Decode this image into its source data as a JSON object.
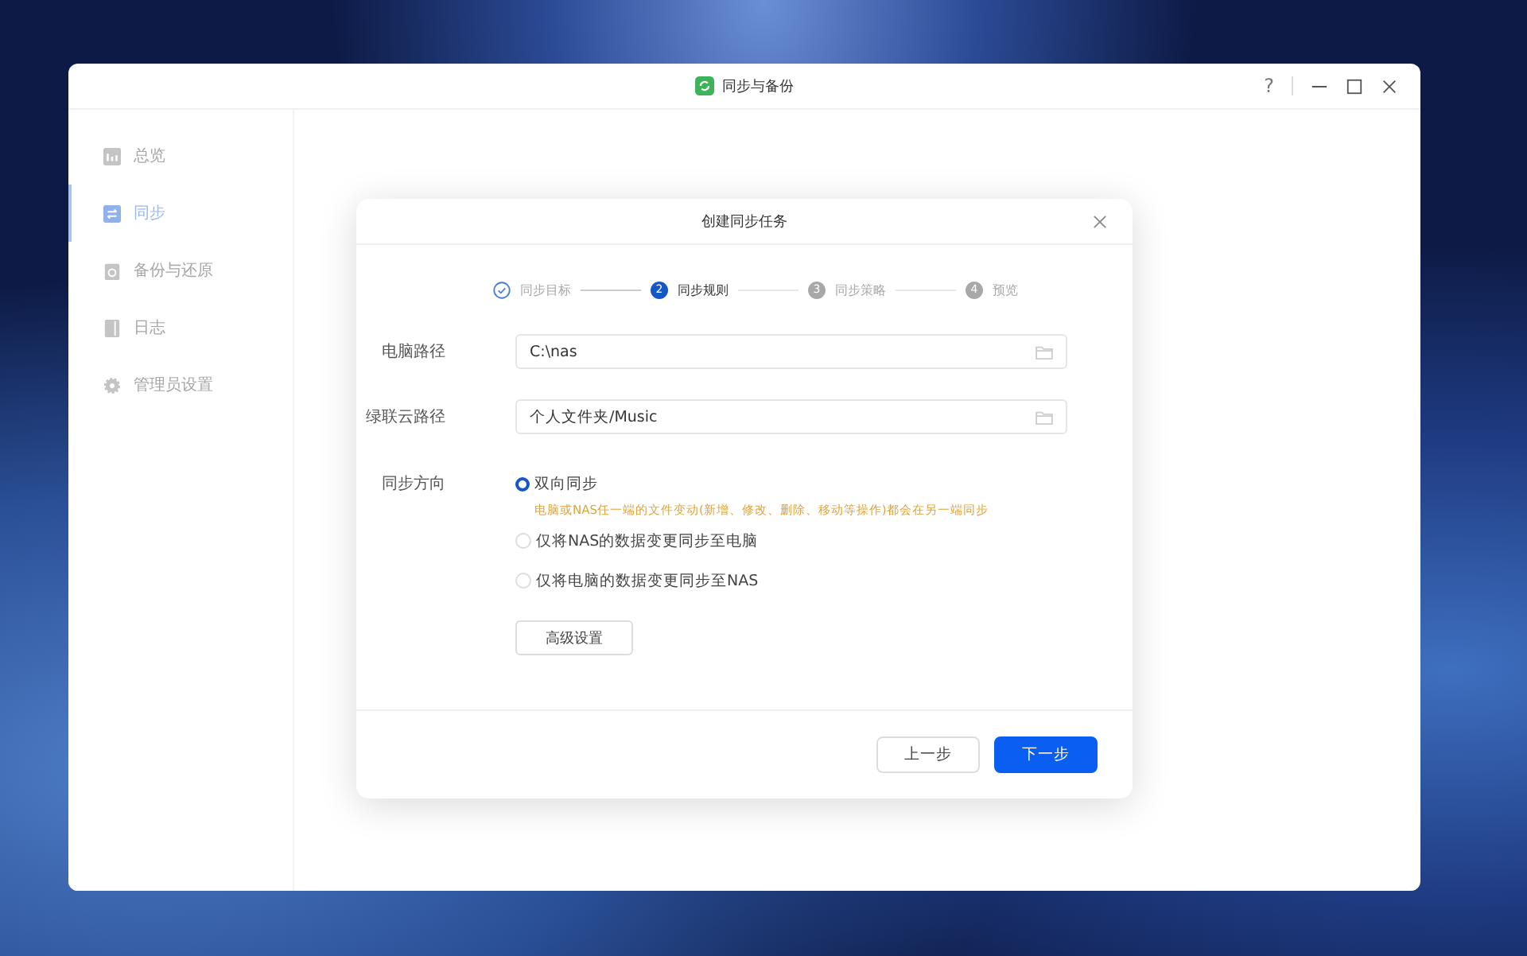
{
  "window": {
    "title": "同步与备份",
    "help": "?"
  },
  "sidebar": {
    "items": [
      {
        "label": "总览",
        "selected": false
      },
      {
        "label": "同步",
        "selected": true
      },
      {
        "label": "备份与还原",
        "selected": false
      },
      {
        "label": "日志",
        "selected": false
      },
      {
        "label": "管理员设置",
        "selected": false
      }
    ]
  },
  "dialog": {
    "title": "创建同步任务",
    "steps": [
      {
        "label": "同步目标",
        "completed": true,
        "selected": false
      },
      {
        "label": "同步规则",
        "number": "2",
        "completed": false,
        "selected": true
      },
      {
        "label": "同步策略",
        "number": "3",
        "completed": false,
        "selected": false
      },
      {
        "label": "预览",
        "number": "4",
        "completed": false,
        "selected": false
      }
    ],
    "fields": [
      {
        "label": "电脑路径",
        "value": "C:\\nas"
      },
      {
        "label": "绿联云路径",
        "value": "个人文件夹/Music"
      }
    ],
    "direction": {
      "label": "同步方向",
      "options": [
        {
          "label": "双向同步",
          "selected": true,
          "hint": "电脑或NAS任一端的文件变动(新增、修改、删除、移动等操作)都会在另一端同步"
        },
        {
          "label": "仅将NAS的数据变更同步至电脑",
          "selected": false
        },
        {
          "label": "仅将电脑的数据变更同步至NAS",
          "selected": false
        }
      ]
    },
    "advanced_button": "高级设置",
    "buttons": [
      {
        "label": "上一步",
        "kind": "secondary"
      },
      {
        "label": "下一步",
        "kind": "primary"
      }
    ]
  }
}
